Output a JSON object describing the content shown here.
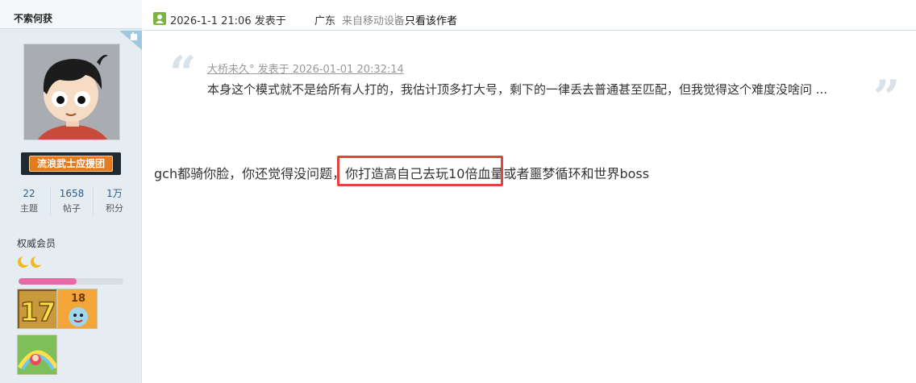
{
  "user": {
    "name": "不索何获",
    "rank_title": "流浪武士应援团",
    "stats": [
      {
        "value": "22",
        "label": "主题"
      },
      {
        "value": "1658",
        "label": "帖子"
      },
      {
        "value": "1万",
        "label": "积分"
      }
    ],
    "group": "权威会员",
    "level_icons": [
      "crescent-moon-icon",
      "crescent-moon-icon"
    ],
    "progress_fraction": 0.55,
    "medals": [
      "medal-17",
      "medal-18",
      "medal-rainbow"
    ]
  },
  "post": {
    "date": "2026-1-1 21:06 发表于",
    "location": "广东",
    "device": "来自移动设备",
    "only_author_label": "只看该作者",
    "quote": {
      "author_line": "大桥未久° 发表于 2026-01-01 20:32:14",
      "text": "本身这个模式就不是给所有人打的，我估计顶多打大号，剩下的一律丢去普通甚至匹配，但我觉得这个难度没啥问 ..."
    },
    "body": "gch都骑你脸，你还觉得没问题，你打造高自己去玩10倍血量或者噩梦循环和世界boss"
  },
  "colors": {
    "sidebar_bg": "#e5edf2",
    "link_blue": "#2f5b85",
    "highlight_red": "#e0453d",
    "progress_pink": "#e66aa8"
  }
}
